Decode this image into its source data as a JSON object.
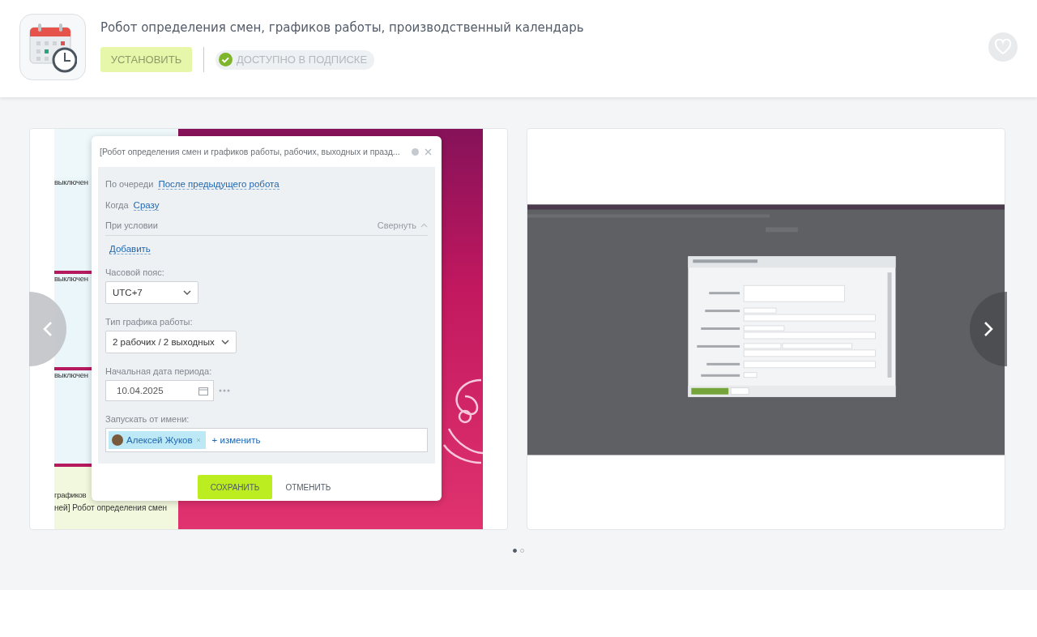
{
  "app": {
    "title": "Робот определения смен, графиков работы, производственный календарь",
    "install_button": {
      "label": "УСТАНОВИТЬ",
      "disabled": true
    },
    "subscription_badge": "ДОСТУПНО В ПОДПИСКЕ",
    "favorite": false
  },
  "carousel": {
    "slides": [
      {
        "kind": "dialog-screenshot",
        "background_texts": [
          "выключен",
          "выключен",
          "выключен"
        ],
        "footer_texts": [
          "графиков",
          "ней] Робот определения смен"
        ],
        "dialog": {
          "title": "[Робот определения смен и графиков работы, рабочих, выходных и празд...",
          "rows": [
            {
              "label": "По очереди",
              "link": "После предыдущего робота"
            },
            {
              "label": "Когда",
              "link": "Сразу"
            }
          ],
          "condition": {
            "label": "При условии",
            "collapse": "Свернуть",
            "add": "Добавить"
          },
          "fields": [
            {
              "kind": "select",
              "label": "Часовой пояс:",
              "value": "UTC+7"
            },
            {
              "kind": "select",
              "label": "Тип графика работы:",
              "value": "2 рабочих / 2 выходных"
            },
            {
              "kind": "date",
              "label": "Начальная дата периода:",
              "value": "10.04.2025"
            },
            {
              "kind": "user",
              "label": "Запускать от имени:",
              "value": "Алексей Жуков",
              "action": "+ изменить"
            }
          ],
          "buttons": [
            {
              "kind": "primary",
              "label": "СОХРАНИТЬ"
            },
            {
              "kind": "plain",
              "label": "ОТМЕНИТЬ"
            }
          ]
        }
      },
      {
        "kind": "dark-screenshot"
      }
    ],
    "dots": [
      {
        "selected": true
      },
      {
        "selected": false
      }
    ]
  }
}
